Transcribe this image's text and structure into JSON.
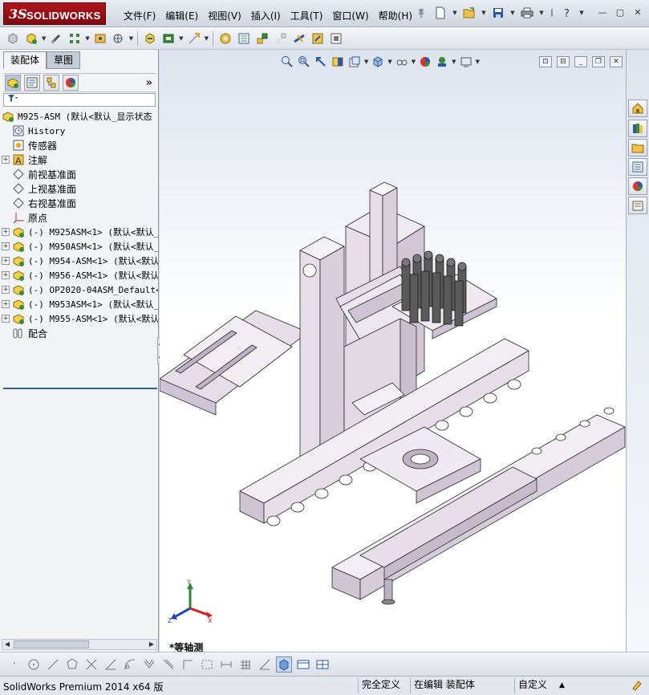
{
  "app": {
    "logo_ds": "3S",
    "logo_brand": "SOLIDWORKS"
  },
  "menu": [
    "文件(F)",
    "编辑(E)",
    "视图(V)",
    "插入(I)",
    "工具(T)",
    "窗口(W)",
    "帮助(H)"
  ],
  "quick_toolbar": {
    "icons": [
      "pin-icon",
      "new-document-icon",
      "open-icon",
      "save-icon",
      "print-icon",
      "options-icon",
      "help-icon"
    ]
  },
  "panel": {
    "tabs": [
      "装配体",
      "草图"
    ],
    "active_tab": "装配体",
    "more_symbol": "»"
  },
  "tree": {
    "root": "M925-ASM  (默认<默认_显示状态",
    "items": [
      {
        "label": "History",
        "icon": "history-icon",
        "expandable": false,
        "cn": false
      },
      {
        "label": "传感器",
        "icon": "sensor-icon",
        "expandable": false,
        "cn": true
      },
      {
        "label": "注解",
        "icon": "annotation-icon",
        "expandable": true,
        "cn": true
      },
      {
        "label": "前视基准面",
        "icon": "plane-icon",
        "expandable": false,
        "cn": true
      },
      {
        "label": "上视基准面",
        "icon": "plane-icon",
        "expandable": false,
        "cn": true
      },
      {
        "label": "右视基准面",
        "icon": "plane-icon",
        "expandable": false,
        "cn": true
      },
      {
        "label": "原点",
        "icon": "origin-icon",
        "expandable": false,
        "cn": true
      },
      {
        "label": "(-) M925ASM<1> (默认<默认_",
        "icon": "assembly-icon",
        "expandable": true,
        "cn": false
      },
      {
        "label": "(-) M950ASM<1> (默认<默认_",
        "icon": "assembly-icon",
        "expandable": true,
        "cn": false
      },
      {
        "label": "(-) M954-ASM<1> (默认<默认",
        "icon": "assembly-icon",
        "expandable": true,
        "cn": false
      },
      {
        "label": "(-) M956-ASM<1> (默认<默认",
        "icon": "assembly-icon",
        "expandable": true,
        "cn": false
      },
      {
        "label": "(-) OP2020-04ASM_Default<",
        "icon": "assembly-icon",
        "expandable": true,
        "cn": false
      },
      {
        "label": "(-) M953ASM<1> (默认<默认_",
        "icon": "assembly-icon",
        "expandable": true,
        "cn": false
      },
      {
        "label": "(-) M955-ASM<1> (默认<默认",
        "icon": "assembly-icon",
        "expandable": true,
        "cn": false
      },
      {
        "label": "配合",
        "icon": "mates-icon",
        "expandable": false,
        "cn": true
      }
    ]
  },
  "viewport": {
    "view_name": "*等轴测",
    "triad": {
      "x": "X",
      "y": "Y",
      "z": "Z"
    }
  },
  "status": {
    "app_version": "SolidWorks Premium 2014 x64 版",
    "definition": "完全定义",
    "editing": "在编辑 装配体",
    "units": "自定义",
    "units_arrow": "▲"
  },
  "colors": {
    "accent": "#b0141c",
    "model_fill": "#e6dde8",
    "model_edge": "#2a2a2a"
  }
}
